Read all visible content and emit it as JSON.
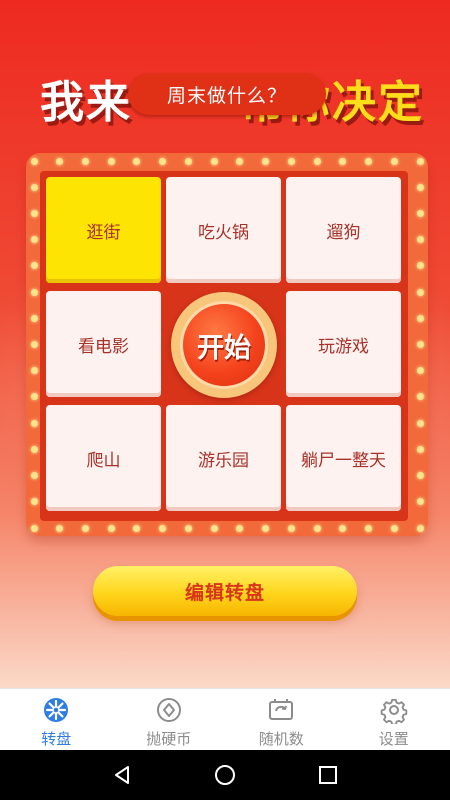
{
  "header": {
    "banner_left": "我来",
    "banner_right": "帮你决定",
    "title": "周末做什么？"
  },
  "board": {
    "active_index": 0,
    "cells": [
      {
        "label": "逛街"
      },
      {
        "label": "吃火锅"
      },
      {
        "label": "遛狗"
      },
      {
        "label": "看电影"
      },
      {
        "label": "玩游戏"
      },
      {
        "label": "爬山"
      },
      {
        "label": "游乐园"
      },
      {
        "label": "躺尸一整天"
      }
    ],
    "start_label": "开始"
  },
  "edit_button_label": "编辑转盘",
  "tabs": [
    {
      "label": "转盘",
      "icon": "wheel-icon",
      "active": true
    },
    {
      "label": "抛硬币",
      "icon": "coin-icon",
      "active": false
    },
    {
      "label": "随机数",
      "icon": "random-number-icon",
      "active": false
    },
    {
      "label": "设置",
      "icon": "gear-icon",
      "active": false
    }
  ],
  "colors": {
    "primary_red": "#ee2a20",
    "cell_highlight": "#fde403",
    "button_yellow": "#ffd51c",
    "tab_active": "#2f7de1",
    "tab_inactive": "#8c8c8c"
  },
  "system_nav": {
    "back": "back-icon",
    "home": "home-icon",
    "recents": "recents-icon"
  }
}
